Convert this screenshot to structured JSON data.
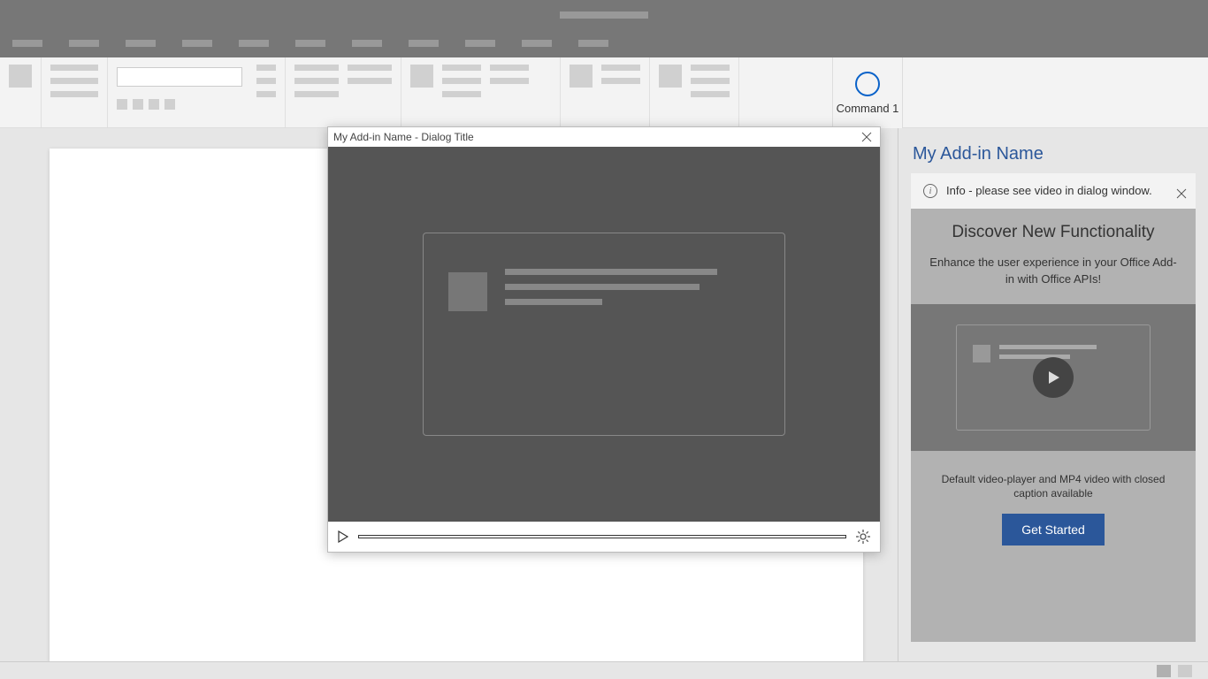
{
  "ribbon": {
    "command1_label": "Command 1"
  },
  "dialog": {
    "title": "My Add-in Name - Dialog Title"
  },
  "taskpane": {
    "title": "My Add-in Name",
    "info_text": "Info - please see video in dialog window.",
    "heading": "Discover New Functionality",
    "body": "Enhance the user experience in your Office Add-in with Office APIs!",
    "caption": "Default video-player and MP4 video with closed caption available",
    "button_label": "Get Started"
  }
}
